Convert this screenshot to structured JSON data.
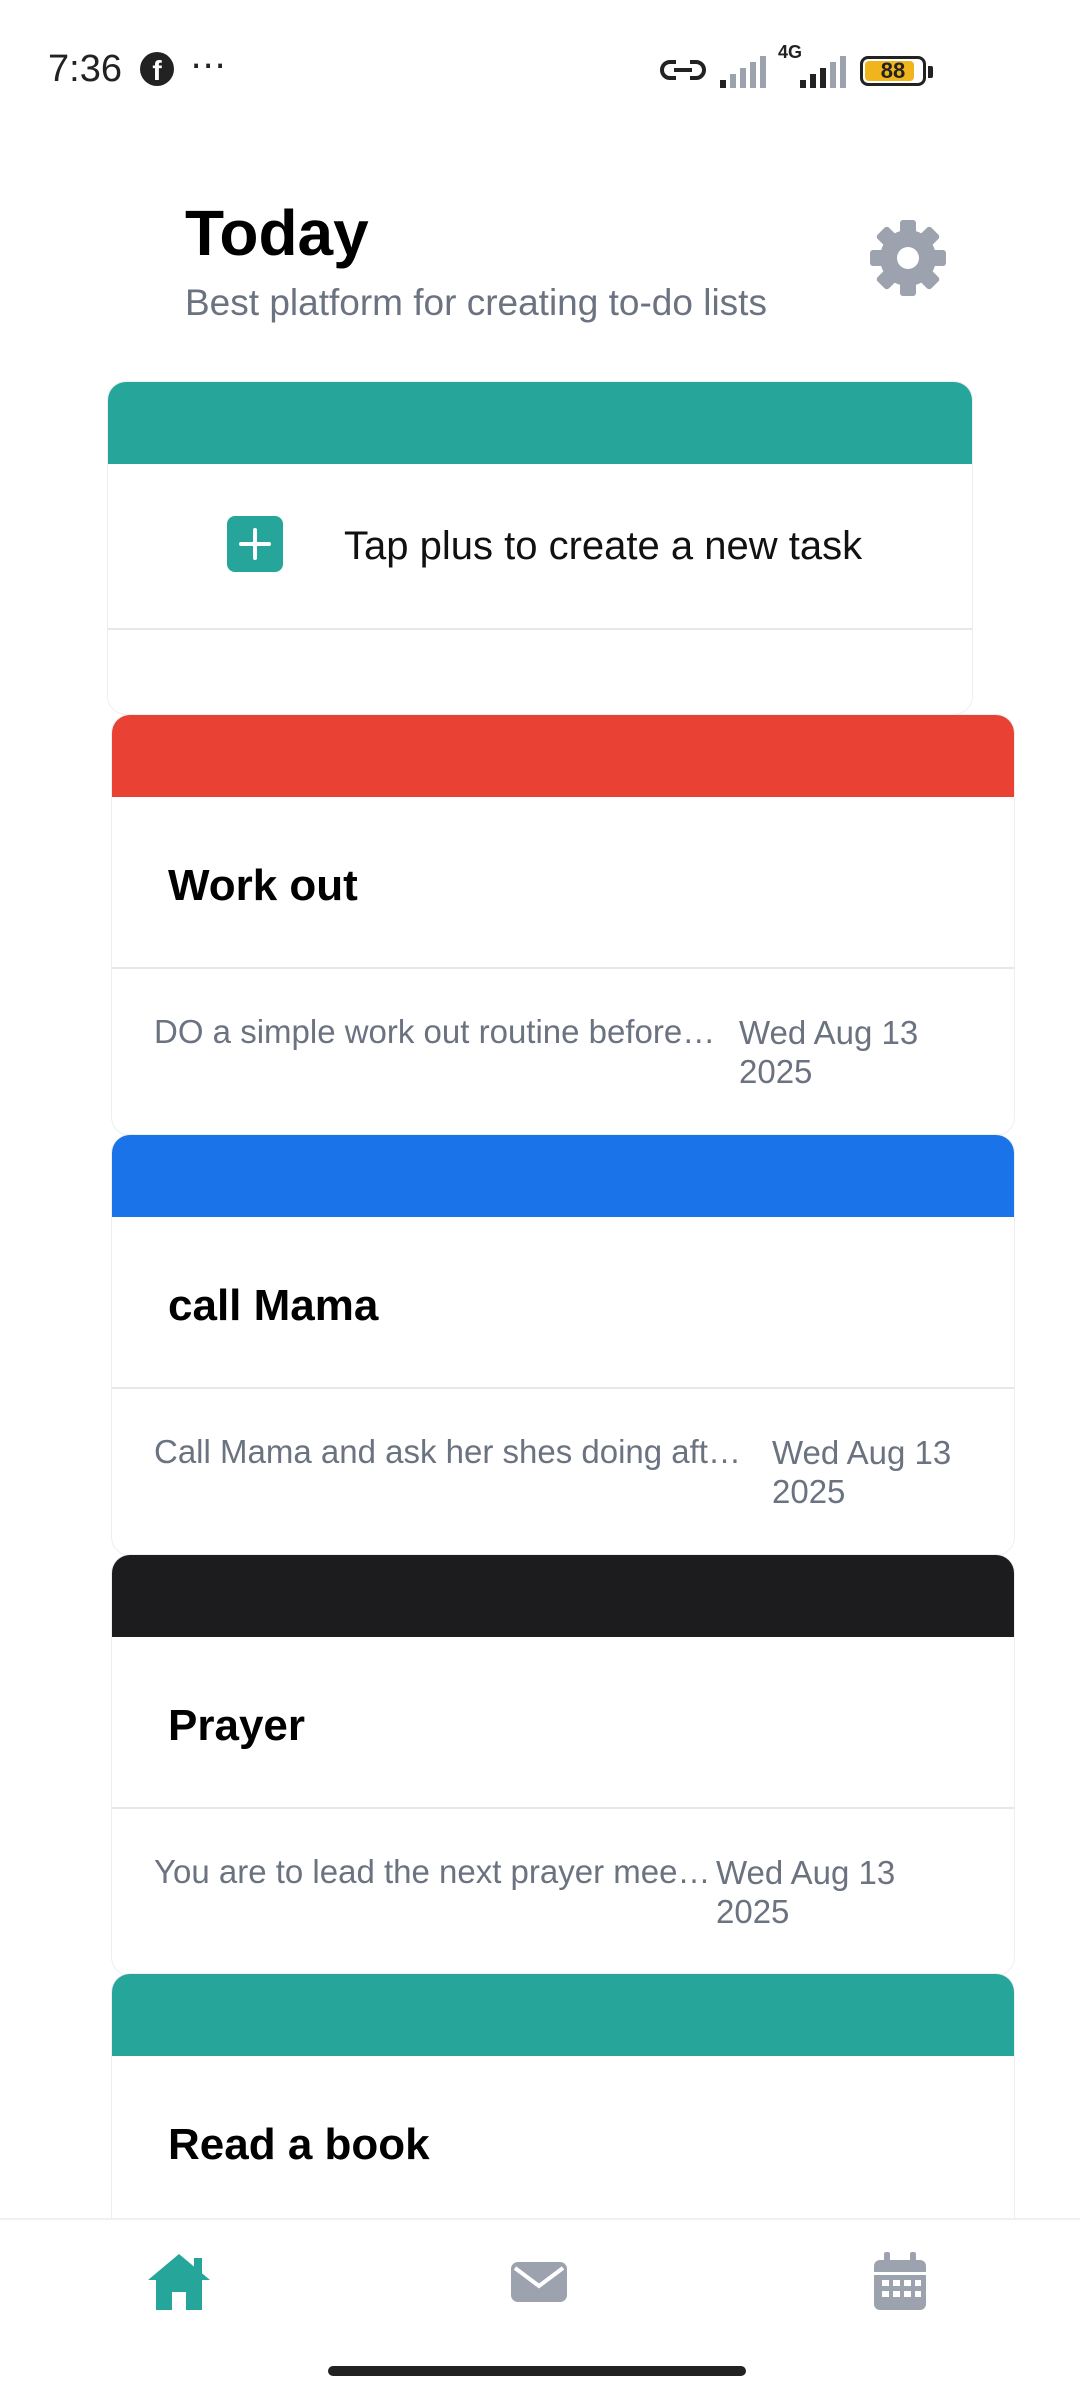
{
  "status_bar": {
    "time": "7:36",
    "notification_icons": [
      "facebook-icon",
      "more-dots-icon"
    ],
    "network_label": "4G",
    "battery": "88"
  },
  "header": {
    "title": "Today",
    "subtitle": "Best platform for creating to-do lists",
    "settings_icon": "gear-icon"
  },
  "new_task": {
    "label": "Tap plus to create a new task",
    "band_color": "#26a69a",
    "icon": "plus-icon"
  },
  "tasks": [
    {
      "title": "Work out",
      "description": "DO a simple work out routine before 1…",
      "date": "Wed Aug 13 2025",
      "color": "#e94235"
    },
    {
      "title": "call Mama",
      "description": "Call Mama and ask her shes doing after …",
      "date": "Wed Aug 13 2025",
      "color": "#1a73e8"
    },
    {
      "title": "Prayer",
      "description": "You are to lead the next prayer meeti…",
      "date": "Wed Aug 13 2025",
      "color": "#1c1c1e"
    },
    {
      "title": "Read a book",
      "description": "",
      "date": "",
      "color": "#26a69a"
    }
  ],
  "bottom_nav": {
    "items": [
      {
        "icon": "home-icon",
        "active": true
      },
      {
        "icon": "mail-icon",
        "active": false
      },
      {
        "icon": "calendar-icon",
        "active": false
      }
    ],
    "active_color": "#26a69a",
    "inactive_color": "#9ca3af"
  }
}
